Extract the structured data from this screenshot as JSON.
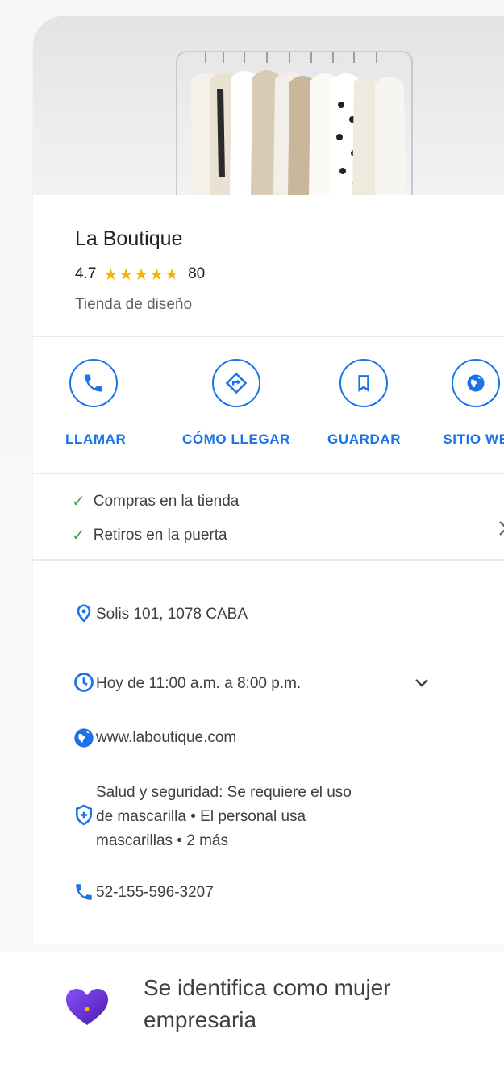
{
  "business": {
    "name": "La Boutique",
    "rating": "4.7",
    "stars": 4.7,
    "review_count": "80",
    "category": "Tienda de diseño"
  },
  "actions": [
    {
      "label": "LLAMAR",
      "icon": "phone-icon"
    },
    {
      "label": "CÓMO LLEGAR",
      "icon": "directions-icon"
    },
    {
      "label": "GUARDAR",
      "icon": "bookmark-icon"
    },
    {
      "label": "SITIO WE",
      "icon": "globe-icon"
    }
  ],
  "features": [
    "Compras en la tienda",
    "Retiros en la puerta"
  ],
  "info": {
    "address": "Solis 101, 1078 CABA",
    "hours": "Hoy de 11:00 a.m. a 8:00 p.m.",
    "website": "www.laboutique.com",
    "health_line1": "Salud y seguridad: Se requiere el uso",
    "health_line2": "de mascarilla • El personal usa",
    "health_line3": "mascarillas • 2 más",
    "phone": "52-155-596-3207"
  },
  "bottom": {
    "line1": "Se identifica como mujer",
    "line2": "empresaria",
    "icon": "heart-icon"
  },
  "colors": {
    "accent_blue": "#1a73e8",
    "star": "#f6b400",
    "check_green": "#34a853",
    "heart_purple": "#6b2bdc"
  }
}
